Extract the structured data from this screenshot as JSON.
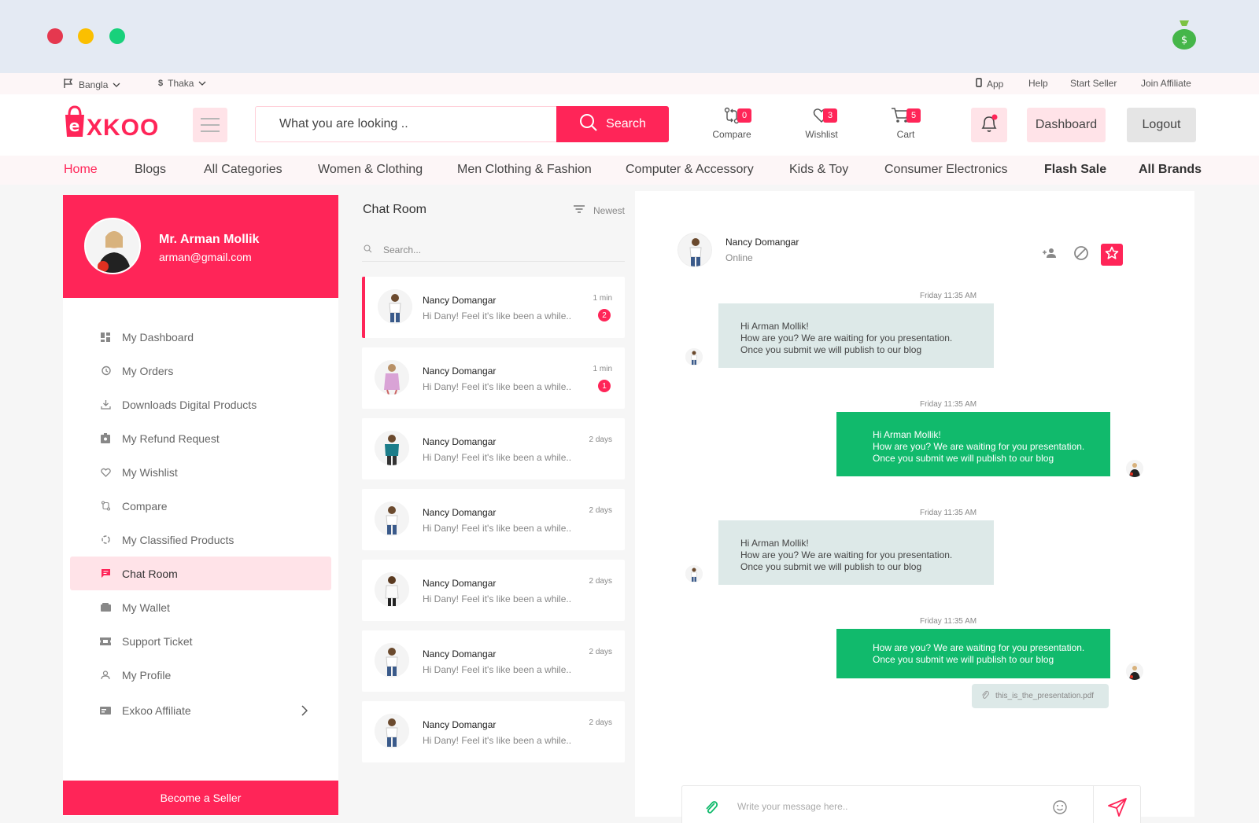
{
  "window": {
    "dot_colors": [
      "#e5384f",
      "#fbbf00",
      "#18d17b"
    ],
    "extension_icon": "money-bag-icon"
  },
  "colors": {
    "accent": "#ff2558",
    "accent_soft": "#ffe3e8",
    "green": "#11ba6c",
    "incoming_bubble": "#dde9e8"
  },
  "topbar": {
    "language": "Bangla",
    "currency": "Thaka",
    "links": [
      "App",
      "Help",
      "Start Seller",
      "Join Affiliate"
    ]
  },
  "header": {
    "logo_text": "XKOO",
    "search_placeholder": "What you are looking ..",
    "search_button": "Search",
    "compare": {
      "label": "Compare",
      "count": "0"
    },
    "wishlist": {
      "label": "Wishlist",
      "count": "3"
    },
    "cart": {
      "label": "Cart",
      "count": "5"
    },
    "dashboard_button": "Dashboard",
    "logout_button": "Logout"
  },
  "nav": [
    "Home",
    "Blogs",
    "All Categories",
    "Women & Clothing",
    "Men Clothing & Fashion",
    "Computer & Accessory",
    "Kids & Toy",
    "Consumer Electronics",
    "Flash Sale",
    "All Brands"
  ],
  "profile": {
    "name": "Mr. Arman Mollik",
    "email": "arman@gmail.com"
  },
  "sidebar": {
    "items": [
      {
        "label": "My Dashboard",
        "icon": "dashboard-icon"
      },
      {
        "label": "My Orders",
        "icon": "history-icon"
      },
      {
        "label": "Downloads Digital Products",
        "icon": "download-icon"
      },
      {
        "label": "My Refund Request",
        "icon": "refund-icon"
      },
      {
        "label": "My Wishlist",
        "icon": "heart-icon"
      },
      {
        "label": "Compare",
        "icon": "compare-icon"
      },
      {
        "label": "My Classified Products",
        "icon": "classified-icon"
      },
      {
        "label": "Chat Room",
        "icon": "chat-icon",
        "active": true
      },
      {
        "label": "My Wallet",
        "icon": "wallet-icon"
      },
      {
        "label": "Support Ticket",
        "icon": "ticket-icon"
      },
      {
        "label": "My Profile",
        "icon": "user-icon"
      },
      {
        "label": "Exkoo Affiliate",
        "icon": "affiliate-icon"
      }
    ],
    "become_seller": "Become a Seller"
  },
  "chat_list": {
    "title": "Chat Room",
    "sort_label": "Newest",
    "search_placeholder": "Search...",
    "items": [
      {
        "name": "Nancy Domangar",
        "message": "Hi Dany! Feel it's like been a while..",
        "time": "1 min",
        "unread": "2"
      },
      {
        "name": "Nancy Domangar",
        "message": "Hi Dany! Feel it's like been a while..",
        "time": "1 min",
        "unread": "1"
      },
      {
        "name": "Nancy Domangar",
        "message": "Hi Dany! Feel it's like been a while..",
        "time": "2 days",
        "unread": ""
      },
      {
        "name": "Nancy Domangar",
        "message": "Hi Dany! Feel it's like been a while..",
        "time": "2 days",
        "unread": ""
      },
      {
        "name": "Nancy Domangar",
        "message": "Hi Dany! Feel it's like been a while..",
        "time": "2 days",
        "unread": ""
      },
      {
        "name": "Nancy Domangar",
        "message": "Hi Dany! Feel it's like been a while..",
        "time": "2 days",
        "unread": ""
      },
      {
        "name": "Nancy Domangar",
        "message": "Hi Dany! Feel it's like been a while..",
        "time": "2 days",
        "unread": ""
      }
    ]
  },
  "conversation": {
    "contact_name": "Nancy Domangar",
    "status": "Online",
    "messages": [
      {
        "time": "Friday 11:35 AM",
        "direction": "in",
        "lines": [
          "Hi Arman Mollik!",
          "How are you? We are waiting for you presentation.",
          "Once you submit we will publish to our blog"
        ]
      },
      {
        "time": "Friday 11:35 AM",
        "direction": "out",
        "lines": [
          "Hi Arman Mollik!",
          "How are you? We are waiting for you presentation.",
          "Once you submit we will publish to our blog"
        ]
      },
      {
        "time": "Friday 11:35 AM",
        "direction": "in",
        "lines": [
          "Hi Arman Mollik!",
          "How are you? We are waiting for you presentation.",
          "Once you submit we will publish to our blog"
        ]
      },
      {
        "time": "Friday 11:35 AM",
        "direction": "out",
        "lines": [
          "How are you? We are waiting for you presentation.",
          "Once you submit we will publish to our blog"
        ]
      }
    ],
    "attachment": "this_is_the_presentation.pdf",
    "composer_placeholder": "Write your message here.."
  }
}
